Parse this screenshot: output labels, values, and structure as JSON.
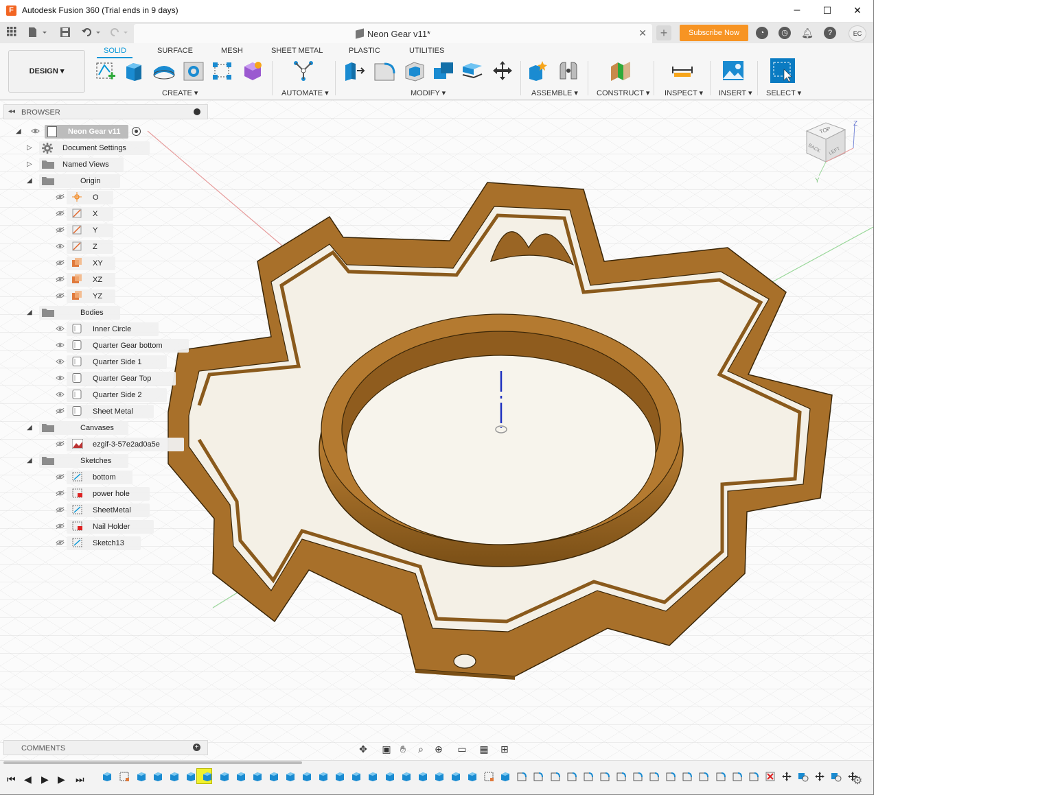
{
  "window": {
    "title": "Autodesk Fusion 360 (Trial ends in 9 days)",
    "app_icon_letter": "F",
    "controls": [
      "–",
      "☐",
      "✕"
    ]
  },
  "doc_tab": {
    "title": "Neon Gear v11*",
    "close": "✕"
  },
  "subscribe_label": "Subscribe Now",
  "avatar_initials": "EC",
  "design_label": "DESIGN ▾",
  "workspace_tabs": [
    {
      "label": "SOLID",
      "active": true
    },
    {
      "label": "SURFACE"
    },
    {
      "label": "MESH"
    },
    {
      "label": "SHEET METAL"
    },
    {
      "label": "PLASTIC"
    },
    {
      "label": "UTILITIES"
    }
  ],
  "tool_groups": [
    {
      "label": "CREATE ▾"
    },
    {
      "label": "AUTOMATE ▾"
    },
    {
      "label": "MODIFY ▾"
    },
    {
      "label": "ASSEMBLE ▾"
    },
    {
      "label": "CONSTRUCT ▾"
    },
    {
      "label": "INSPECT ▾"
    },
    {
      "label": "INSERT ▾"
    },
    {
      "label": "SELECT ▾"
    }
  ],
  "browser": {
    "title": "BROWSER",
    "root": "Neon Gear v11",
    "items": [
      {
        "label": "Document Settings"
      },
      {
        "label": "Named Views"
      },
      {
        "label": "Origin"
      },
      {
        "label": "O"
      },
      {
        "label": "X"
      },
      {
        "label": "Y"
      },
      {
        "label": "Z"
      },
      {
        "label": "XY"
      },
      {
        "label": "XZ"
      },
      {
        "label": "YZ"
      },
      {
        "label": "Bodies"
      },
      {
        "label": "Inner Circle"
      },
      {
        "label": "Quarter Gear bottom"
      },
      {
        "label": "Quarter Side 1"
      },
      {
        "label": "Quarter Gear Top"
      },
      {
        "label": "Quarter Side 2"
      },
      {
        "label": "Sheet Metal"
      },
      {
        "label": "Canvases"
      },
      {
        "label": "ezgif-3-57e2ad0a5e"
      },
      {
        "label": "Sketches"
      },
      {
        "label": "bottom"
      },
      {
        "label": "power hole"
      },
      {
        "label": "SheetMetal"
      },
      {
        "label": "Nail Holder"
      },
      {
        "label": "Sketch13"
      }
    ]
  },
  "comments_label": "COMMENTS",
  "viewcube": {
    "top": "TOP",
    "left": "LEFT",
    "back": "BACK",
    "axis_z": "Z",
    "axis_y": "Y"
  },
  "colors": {
    "accent": "#0696d7",
    "subscribe": "#f79423",
    "gear": "#a7702a",
    "timeline_marker": "#f1f12e"
  }
}
